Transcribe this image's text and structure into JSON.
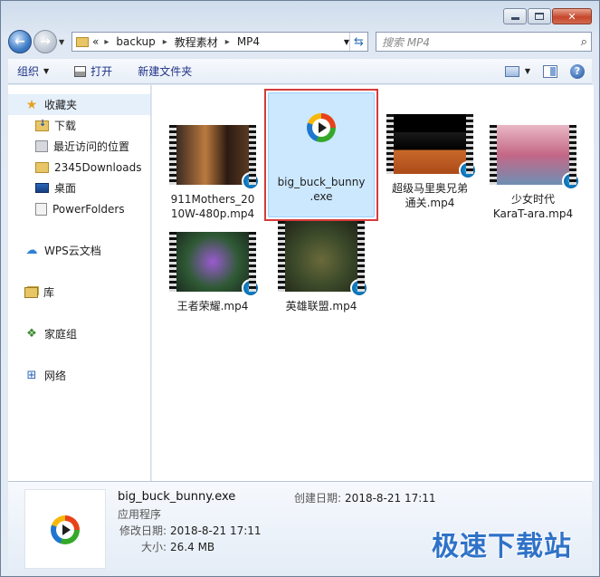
{
  "window": {
    "caption_icons": [
      "minimize-icon",
      "maximize-icon",
      "close-icon"
    ]
  },
  "address": {
    "prefix": "«",
    "crumbs": [
      "backup",
      "教程素材",
      "MP4"
    ],
    "separator": "▸"
  },
  "search": {
    "placeholder": "搜索 MP4"
  },
  "toolbar": {
    "organize": "组织",
    "open": "打开",
    "new_folder": "新建文件夹"
  },
  "sidebar": {
    "favorites": "收藏夹",
    "fav_items": [
      "下载",
      "最近访问的位置",
      "2345Downloads",
      "桌面",
      "PowerFolders"
    ],
    "wps": "WPS云文档",
    "library": "库",
    "homegroup": "家庭组",
    "network": "网络"
  },
  "files": [
    {
      "name_line1": "911Mothers_20",
      "name_line2": "10W-480p.mp4"
    },
    {
      "name_line1": "big_buck_bunny",
      "name_line2": ".exe"
    },
    {
      "name_line1": "超级马里奥兄弟",
      "name_line2": "通关.mp4"
    },
    {
      "name_line1": "少女时代",
      "name_line2": "KaraT-ara.mp4"
    },
    {
      "name_line1": "王者荣耀.mp4",
      "name_line2": ""
    },
    {
      "name_line1": "英雄联盟.mp4",
      "name_line2": ""
    }
  ],
  "details": {
    "name": "big_buck_bunny.exe",
    "type": "应用程序",
    "modified_label": "修改日期:",
    "modified_value": "2018-8-21 17:11",
    "size_label": "大小:",
    "size_value": "26.4 MB",
    "created_label": "创建日期:",
    "created_value": "2018-8-21 17:11"
  },
  "watermark": "极速下载站",
  "colors": {
    "selection_fill": "#cce8ff",
    "highlight_frame": "#d83a3a",
    "toolbar_text": "#1e3287"
  }
}
